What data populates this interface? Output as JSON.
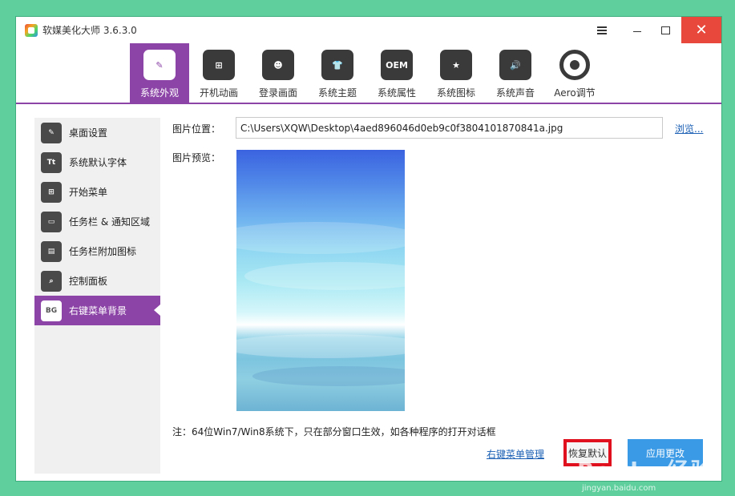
{
  "window": {
    "title": "软媒美化大师 3.6.3.0",
    "close_glyph": "✕"
  },
  "toolbar": {
    "items": [
      {
        "label": "系统外观",
        "icon": "paintbrush-icon",
        "glyph": "✎"
      },
      {
        "label": "开机动画",
        "icon": "windows-logo-icon",
        "glyph": "⊞"
      },
      {
        "label": "登录画面",
        "icon": "user-portrait-icon",
        "glyph": "☻"
      },
      {
        "label": "系统主题",
        "icon": "tshirt-icon",
        "glyph": "👕"
      },
      {
        "label": "系统属性",
        "icon": "oem-icon",
        "glyph": "OEM"
      },
      {
        "label": "系统图标",
        "icon": "star-icon",
        "glyph": "★"
      },
      {
        "label": "系统声音",
        "icon": "speaker-icon",
        "glyph": "🔊"
      },
      {
        "label": "Aero调节",
        "icon": "aero-circle-icon",
        "glyph": ""
      }
    ],
    "active_index": 0,
    "accent_color": "#8c44a7"
  },
  "sidebar": {
    "items": [
      {
        "label": "桌面设置",
        "icon": "desktop-brush-icon",
        "glyph": "✎"
      },
      {
        "label": "系统默认字体",
        "icon": "font-icon",
        "glyph": "Tt"
      },
      {
        "label": "开始菜单",
        "icon": "start-menu-icon",
        "glyph": "⊞"
      },
      {
        "label": "任务栏 & 通知区域",
        "icon": "taskbar-icon",
        "glyph": "▭"
      },
      {
        "label": "任务栏附加图标",
        "icon": "taskbar-addon-icon",
        "glyph": "▤"
      },
      {
        "label": "控制面板",
        "icon": "control-panel-icon",
        "glyph": "⌕"
      },
      {
        "label": "右键菜单背景",
        "icon": "bg-icon",
        "glyph": "BG"
      }
    ],
    "active_index": 6
  },
  "main": {
    "image_path_label": "图片位置：",
    "image_path_value": "C:\\Users\\XQW\\Desktop\\4aed896046d0eb9c0f3804101870841a.jpg",
    "browse_label": "浏览...",
    "preview_label": "图片预览：",
    "note": "注：64位Win7/Win8系统下，只在部分窗口生效，如各种程序的打开对话框",
    "context_menu_manager_label": "右键菜单管理",
    "restore_default_label": "恢复默认",
    "apply_label": "应用更改"
  },
  "watermark": {
    "text": "Baidu 经验",
    "url": "jingyan.baidu.com"
  }
}
